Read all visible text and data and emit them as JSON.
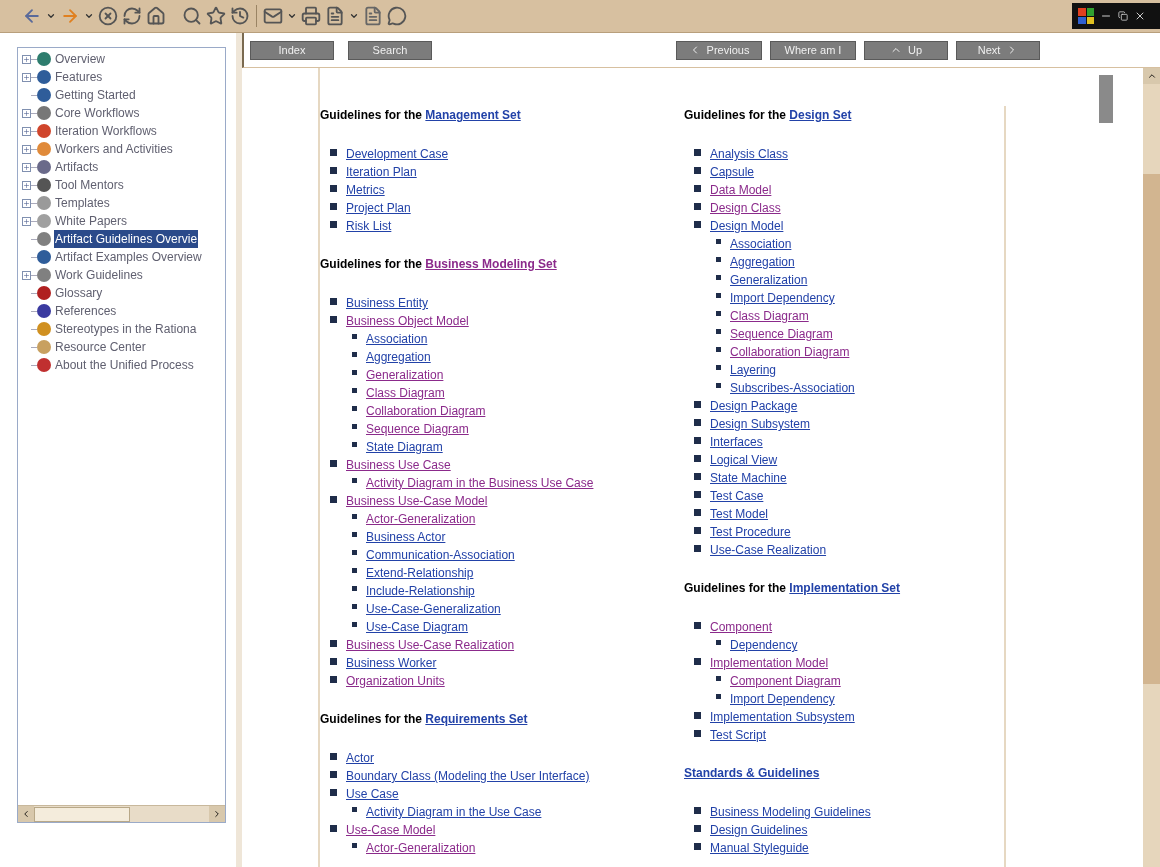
{
  "tree": {
    "items": [
      {
        "label": "Overview",
        "expandable": true,
        "selected": false,
        "color": "#2e7d6e"
      },
      {
        "label": "Features",
        "expandable": true,
        "selected": false,
        "color": "#2f5d9a"
      },
      {
        "label": "Getting Started",
        "expandable": false,
        "selected": false,
        "color": "#2f5d9a"
      },
      {
        "label": "Core Workflows",
        "expandable": true,
        "selected": false,
        "color": "#777777"
      },
      {
        "label": "Iteration Workflows",
        "expandable": true,
        "selected": false,
        "color": "#d0452b"
      },
      {
        "label": "Workers and Activities",
        "expandable": true,
        "selected": false,
        "color": "#e08a3a"
      },
      {
        "label": "Artifacts",
        "expandable": true,
        "selected": false,
        "color": "#6a6a8a"
      },
      {
        "label": "Tool Mentors",
        "expandable": true,
        "selected": false,
        "color": "#555555"
      },
      {
        "label": "Templates",
        "expandable": true,
        "selected": false,
        "color": "#9a9a9a"
      },
      {
        "label": "White Papers",
        "expandable": true,
        "selected": false,
        "color": "#a0a0a0"
      },
      {
        "label": "Artifact Guidelines Overvie",
        "expandable": false,
        "selected": true,
        "color": "#808080"
      },
      {
        "label": "Artifact Examples Overview",
        "expandable": false,
        "selected": false,
        "color": "#2f5d9a"
      },
      {
        "label": "Work Guidelines",
        "expandable": true,
        "selected": false,
        "color": "#808080"
      },
      {
        "label": "Glossary",
        "expandable": false,
        "selected": false,
        "color": "#b02020"
      },
      {
        "label": "References",
        "expandable": false,
        "selected": false,
        "color": "#3a3aa0"
      },
      {
        "label": "Stereotypes in the Rationa",
        "expandable": false,
        "selected": false,
        "color": "#d09020"
      },
      {
        "label": "Resource Center",
        "expandable": false,
        "selected": false,
        "color": "#c8a060"
      },
      {
        "label": "About the Unified Process",
        "expandable": false,
        "selected": false,
        "color": "#c03030"
      }
    ]
  },
  "nav": {
    "left": [
      {
        "label": "Index"
      },
      {
        "label": "Search"
      }
    ],
    "right": [
      {
        "label": "Previous",
        "kind": "prev"
      },
      {
        "label": "Where am I",
        "kind": "plain"
      },
      {
        "label": "Up",
        "kind": "up"
      },
      {
        "label": "Next",
        "kind": "next"
      }
    ]
  },
  "columns": [
    [
      {
        "prefix": "Guidelines for the ",
        "link": {
          "text": "Management Set",
          "visited": false
        },
        "items": [
          {
            "text": "Development Case",
            "visited": false
          },
          {
            "text": "Iteration Plan",
            "visited": false
          },
          {
            "text": "Metrics",
            "visited": false
          },
          {
            "text": "Project Plan",
            "visited": false
          },
          {
            "text": "Risk List",
            "visited": false
          }
        ]
      },
      {
        "prefix": "Guidelines for the ",
        "link": {
          "text": "Business Modeling Set",
          "visited": true
        },
        "items": [
          {
            "text": "Business Entity",
            "visited": false
          },
          {
            "text": "Business Object Model",
            "visited": true,
            "children": [
              {
                "text": "Association",
                "visited": false
              },
              {
                "text": "Aggregation",
                "visited": false
              },
              {
                "text": "Generalization",
                "visited": true
              },
              {
                "text": "Class Diagram",
                "visited": true
              },
              {
                "text": "Collaboration Diagram",
                "visited": true
              },
              {
                "text": "Sequence Diagram",
                "visited": true
              },
              {
                "text": "State Diagram",
                "visited": false
              }
            ]
          },
          {
            "text": "Business Use Case",
            "visited": true,
            "children": [
              {
                "text": "Activity Diagram in the Business Use Case",
                "visited": true
              }
            ]
          },
          {
            "text": "Business Use-Case Model",
            "visited": true,
            "children": [
              {
                "text": "Actor-Generalization",
                "visited": true
              },
              {
                "text": "Business Actor",
                "visited": false
              },
              {
                "text": "Communication-Association",
                "visited": false
              },
              {
                "text": "Extend-Relationship",
                "visited": false
              },
              {
                "text": "Include-Relationship",
                "visited": false
              },
              {
                "text": "Use-Case-Generalization",
                "visited": false
              },
              {
                "text": "Use-Case Diagram",
                "visited": false
              }
            ]
          },
          {
            "text": "Business Use-Case Realization",
            "visited": true
          },
          {
            "text": "Business Worker",
            "visited": false
          },
          {
            "text": "Organization Units",
            "visited": true
          }
        ]
      },
      {
        "prefix": "Guidelines for the ",
        "link": {
          "text": "Requirements Set",
          "visited": false
        },
        "items": [
          {
            "text": "Actor",
            "visited": false
          },
          {
            "text": "Boundary Class (Modeling the User Interface)",
            "visited": false
          },
          {
            "text": "Use Case",
            "visited": false,
            "children": [
              {
                "text": "Activity Diagram in the Use Case",
                "visited": false
              }
            ]
          },
          {
            "text": "Use-Case Model",
            "visited": true,
            "children": [
              {
                "text": "Actor-Generalization",
                "visited": true
              }
            ]
          }
        ]
      }
    ],
    [
      {
        "prefix": "Guidelines for the ",
        "link": {
          "text": "Design Set",
          "visited": false
        },
        "items": [
          {
            "text": "Analysis Class",
            "visited": false
          },
          {
            "text": "Capsule",
            "visited": false
          },
          {
            "text": "Data Model",
            "visited": true
          },
          {
            "text": "Design Class",
            "visited": true
          },
          {
            "text": "Design Model",
            "visited": false,
            "children": [
              {
                "text": "Association",
                "visited": false
              },
              {
                "text": "Aggregation",
                "visited": false
              },
              {
                "text": "Generalization",
                "visited": false
              },
              {
                "text": "Import Dependency",
                "visited": false
              },
              {
                "text": "Class Diagram",
                "visited": true
              },
              {
                "text": "Sequence Diagram",
                "visited": true
              },
              {
                "text": "Collaboration Diagram",
                "visited": true
              },
              {
                "text": "Layering",
                "visited": false
              },
              {
                "text": "Subscribes-Association",
                "visited": false
              }
            ]
          },
          {
            "text": "Design Package",
            "visited": false
          },
          {
            "text": "Design Subsystem",
            "visited": false
          },
          {
            "text": "Interfaces",
            "visited": false
          },
          {
            "text": "Logical View",
            "visited": false
          },
          {
            "text": "State Machine",
            "visited": false
          },
          {
            "text": "Test Case",
            "visited": false
          },
          {
            "text": "Test Model",
            "visited": false
          },
          {
            "text": "Test Procedure",
            "visited": false
          },
          {
            "text": "Use-Case Realization",
            "visited": false
          }
        ]
      },
      {
        "prefix": "Guidelines for the ",
        "link": {
          "text": "Implementation Set",
          "visited": false
        },
        "items": [
          {
            "text": "Component",
            "visited": true,
            "children": [
              {
                "text": "Dependency",
                "visited": false
              }
            ]
          },
          {
            "text": "Implementation Model",
            "visited": true,
            "children": [
              {
                "text": "Component Diagram",
                "visited": true
              },
              {
                "text": "Import Dependency",
                "visited": false
              }
            ]
          },
          {
            "text": "Implementation Subsystem",
            "visited": false
          },
          {
            "text": "Test Script",
            "visited": false
          }
        ]
      },
      {
        "link": {
          "text": "Standards & Guidelines",
          "visited": false
        },
        "items": [
          {
            "text": "Business Modeling Guidelines",
            "visited": false
          },
          {
            "text": "Design Guidelines",
            "visited": false
          },
          {
            "text": "Manual Styleguide",
            "visited": false
          }
        ]
      }
    ]
  ]
}
